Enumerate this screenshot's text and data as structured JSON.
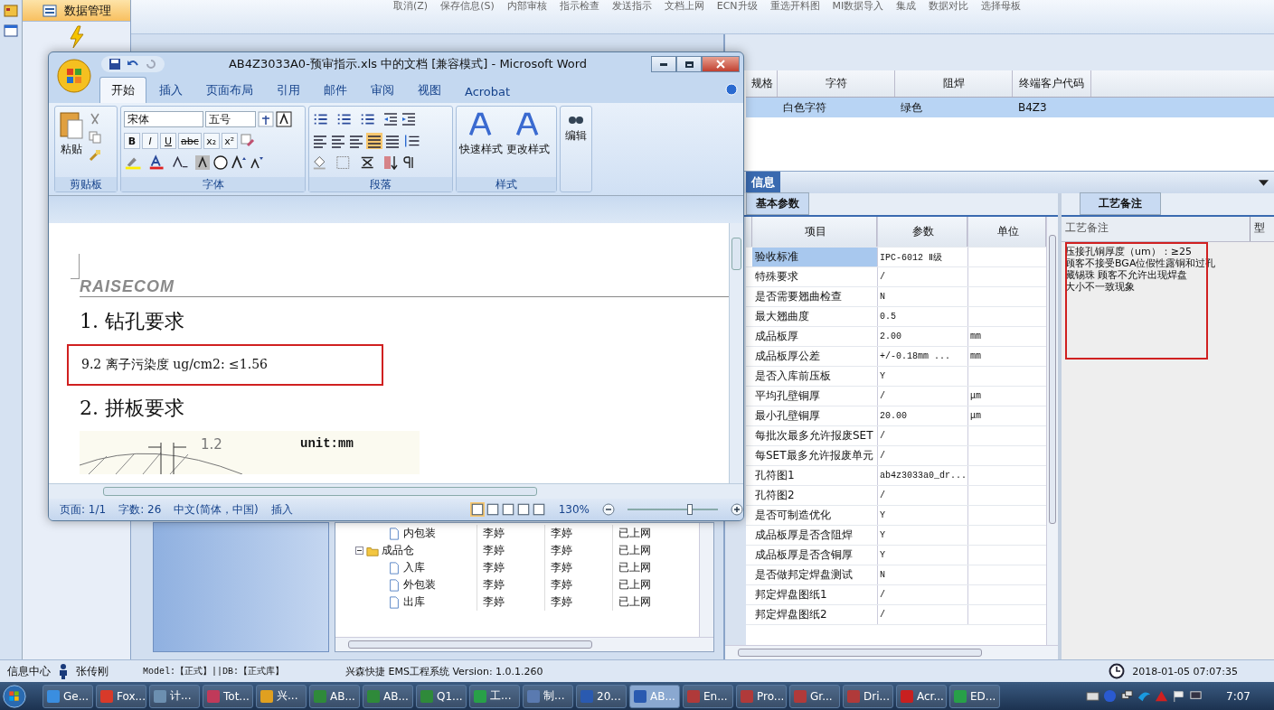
{
  "toolbar": {
    "items": [
      "取消(Z)",
      "保存信息(S)",
      "内部审核",
      "指示检查",
      "发送指示",
      "文档上网",
      "ECN升级",
      "重选开料图",
      "MI数据导入",
      "集成",
      "数据对比",
      "选择母板"
    ]
  },
  "nav": {
    "items": [
      {
        "label": "数据管理",
        "selected": true
      }
    ]
  },
  "spec_grid": {
    "columns": [
      "规格",
      "字符",
      "阻焊",
      "终端客户代码"
    ],
    "rows": [
      {
        "cells": [
          "",
          "白色字符",
          "绿色",
          "B4Z3"
        ],
        "selected": true
      }
    ]
  },
  "info_panel": {
    "title": "信息",
    "tabs": [
      {
        "label": "基本参数",
        "selected": true
      }
    ],
    "columns": [
      "项目",
      "参数",
      "单位"
    ],
    "rows": [
      {
        "item": "验收标准",
        "value": "IPC-6012 Ⅱ级",
        "selected": true
      },
      {
        "item": "特殊要求",
        "value": "/",
        "selected": false
      },
      {
        "item": "是否需要翘曲检查",
        "value": "N",
        "selected": false
      },
      {
        "item": "最大翘曲度",
        "value": "0.5",
        "selected": false
      },
      {
        "item": "成品板厚",
        "value": "2.00",
        "unit": "mm",
        "selected": false
      },
      {
        "item": "成品板厚公差",
        "value": "+/-0.18mm    ...",
        "unit": "mm",
        "selected": false
      },
      {
        "item": "是否入库前压板",
        "value": "Y",
        "selected": false
      },
      {
        "item": "平均孔壁铜厚",
        "value": "/",
        "unit": "μm",
        "selected": false
      },
      {
        "item": "最小孔壁铜厚",
        "value": "20.00",
        "unit": "μm",
        "selected": false
      },
      {
        "item": "每批次最多允许报废SET",
        "value": "/",
        "selected": false
      },
      {
        "item": "每SET最多允许报废单元",
        "value": "/",
        "selected": false
      },
      {
        "item": "孔符图1",
        "value": "ab4z3033a0_dr...",
        "selected": false
      },
      {
        "item": "孔符图2",
        "value": "/",
        "selected": false
      },
      {
        "item": "是否可制造优化",
        "value": "Y",
        "selected": false
      },
      {
        "item": "成品板厚是否含阻焊",
        "value": "Y",
        "selected": false
      },
      {
        "item": "成品板厚是否含铜厚",
        "value": "Y",
        "selected": false
      },
      {
        "item": "是否做邦定焊盘测试",
        "value": "N",
        "selected": false
      },
      {
        "item": "邦定焊盘图纸1",
        "value": "/",
        "selected": false
      },
      {
        "item": "邦定焊盘图纸2",
        "value": "/",
        "selected": false
      }
    ]
  },
  "notes_panel": {
    "tab": "工艺备注",
    "columns": [
      "工艺备注",
      "型"
    ],
    "lines": [
      "压接孔铜厚度（um）：≥25",
      "顾客不接受BGA位假性露铜和过孔",
      "藏锡珠    顾客不允许出现焊盘",
      "大小不一致现象"
    ]
  },
  "tree": {
    "rows": [
      {
        "label": "内包装",
        "cells": [
          "李婷",
          "李婷",
          "已上网"
        ]
      },
      {
        "label": "成品仓",
        "cells": [
          "李婷",
          "李婷",
          "已上网"
        ],
        "expanded": true,
        "children": [
          {
            "label": "入库",
            "cells": [
              "李婷",
              "李婷",
              "已上网"
            ]
          },
          {
            "label": "外包装",
            "cells": [
              "李婷",
              "李婷",
              "已上网"
            ]
          },
          {
            "label": "出库",
            "cells": [
              "李婷",
              "李婷",
              "已上网"
            ]
          }
        ]
      }
    ]
  },
  "word": {
    "title": "AB4Z3033A0-预审指示.xls 中的文档 [兼容模式] - Microsoft Word",
    "tabs": [
      {
        "label": "开始",
        "selected": true
      },
      {
        "label": "插入",
        "selected": false
      },
      {
        "label": "页面布局",
        "selected": false
      },
      {
        "label": "引用",
        "selected": false
      },
      {
        "label": "邮件",
        "selected": false
      },
      {
        "label": "审阅",
        "selected": false
      },
      {
        "label": "视图",
        "selected": false
      },
      {
        "label": "Acrobat",
        "selected": false
      }
    ],
    "font": "宋体",
    "size": "五号",
    "font_buttons": [
      "B",
      "I",
      "U",
      "abc",
      "x₂",
      "x²"
    ],
    "groups": [
      "剪贴板",
      "字体",
      "段落",
      "样式"
    ],
    "paste": "粘贴",
    "styles": [
      "快速样式",
      "更改样式"
    ],
    "edit": "编辑",
    "document": {
      "logo": "RAISECOM",
      "heading1": "1.  钻孔要求",
      "line": "9.2 离子污染度 ug/cm2: ≤1.56",
      "heading2": "2.  拼板要求",
      "figure_dim": "1.2",
      "figure_unit": "unit:mm"
    },
    "status": [
      "页面: 1/1",
      "字数: 26",
      "中文(简体，中国)",
      "插入"
    ],
    "zoom": "130%",
    "zoom_slider": {
      "level": 0.7
    }
  },
  "status_bar": {
    "left": "信息中心",
    "user": "张传刚",
    "model": "Model:【正式】||DB:【正式库】",
    "app": "兴森快捷 EMS工程系统 Version: 1.0.1.260",
    "time": "2018-01-05 07:07:35"
  },
  "taskbar": {
    "items": [
      {
        "label": "Ge...",
        "color": "#3a8ee0",
        "selected": false
      },
      {
        "label": "Fox...",
        "color": "#d83a2a",
        "selected": false
      },
      {
        "label": "计...",
        "color": "#6c8fb0",
        "selected": false
      },
      {
        "label": "Tot...",
        "color": "#c03a5a",
        "selected": false
      },
      {
        "label": "兴...",
        "color": "#e0a020",
        "selected": false
      },
      {
        "label": "AB...",
        "color": "#2f8a3a",
        "selected": false
      },
      {
        "label": "AB...",
        "color": "#2f8a3a",
        "selected": false
      },
      {
        "label": "Q1...",
        "color": "#2f8a3a",
        "selected": false
      },
      {
        "label": "工...",
        "color": "#28a048",
        "selected": false
      },
      {
        "label": "制...",
        "color": "#5a7ab0",
        "selected": false
      },
      {
        "label": "20...",
        "color": "#2a5ab0",
        "selected": false
      },
      {
        "label": "AB...",
        "color": "#2a5ab0",
        "selected": true
      },
      {
        "label": "En...",
        "color": "#b03a3a",
        "selected": false
      },
      {
        "label": "Pro...",
        "color": "#b03a3a",
        "selected": false
      },
      {
        "label": "Gr...",
        "color": "#b03a3a",
        "selected": false
      },
      {
        "label": "Dri...",
        "color": "#b03a3a",
        "selected": false
      },
      {
        "label": "Acr...",
        "color": "#c82020",
        "selected": false
      },
      {
        "label": "ED...",
        "color": "#28a048",
        "selected": false
      }
    ],
    "clock": "7:07"
  }
}
